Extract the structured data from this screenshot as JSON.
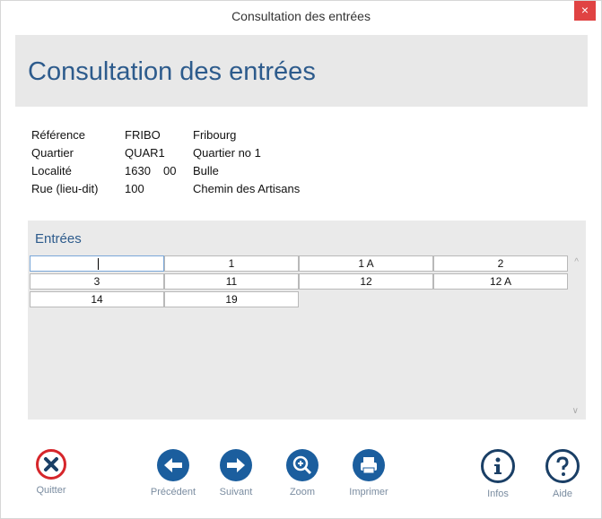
{
  "window": {
    "title": "Consultation des entrées",
    "close_glyph": "×"
  },
  "header": {
    "title": "Consultation des entrées"
  },
  "info": {
    "rows": [
      {
        "label": "Référence",
        "code": "FRIBO",
        "code2": "",
        "desc": "Fribourg"
      },
      {
        "label": "Quartier",
        "code": "QUAR1",
        "code2": "",
        "desc": "Quartier no 1"
      },
      {
        "label": "Localité",
        "code": "1630",
        "code2": "00",
        "desc": "Bulle"
      },
      {
        "label": "Rue (lieu-dit)",
        "code": "100",
        "code2": "",
        "desc": "Chemin des Artisans"
      }
    ]
  },
  "entries": {
    "title": "Entrées",
    "cells": [
      "",
      "1",
      "1 A",
      "2",
      "3",
      "11",
      "12",
      "12 A",
      "14",
      "19"
    ]
  },
  "footer": {
    "quit": {
      "label": "Quitter",
      "icon": "close-circle-icon"
    },
    "prev": {
      "label": "Précédent",
      "icon": "arrow-left-icon"
    },
    "next": {
      "label": "Suivant",
      "icon": "arrow-right-icon"
    },
    "zoom": {
      "label": "Zoom",
      "icon": "zoom-plus-icon"
    },
    "print": {
      "label": "Imprimer",
      "icon": "printer-icon"
    },
    "info": {
      "label": "Infos",
      "icon": "info-icon"
    },
    "help": {
      "label": "Aide",
      "icon": "help-icon"
    }
  },
  "colors": {
    "accent": "#2d5b8c",
    "button_blue": "#1b5e9e",
    "quit_red": "#d6262b",
    "close_red": "#e04343"
  }
}
